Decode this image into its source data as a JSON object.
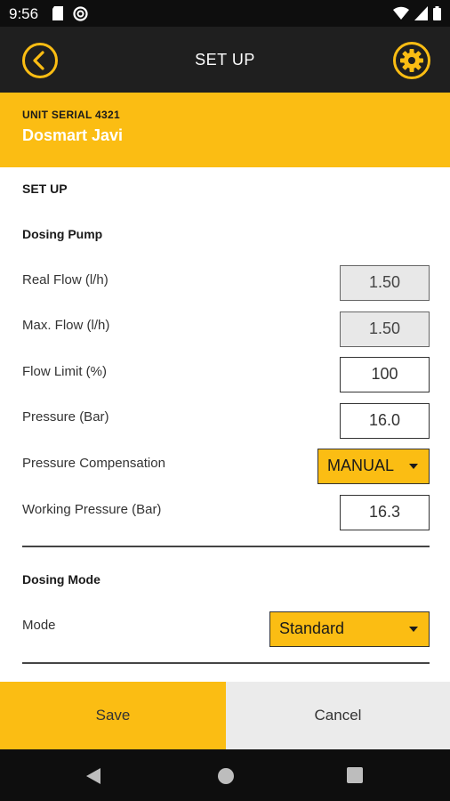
{
  "status_bar": {
    "time": "9:56",
    "icons_left": [
      "sd-card-icon",
      "do-not-disturb-icon"
    ],
    "icons_right": [
      "wifi-icon",
      "cellular-signal-icon",
      "battery-icon"
    ]
  },
  "header": {
    "title": "SET UP",
    "back_icon": "chevron-left-circle-icon",
    "settings_icon": "gear-icon",
    "accent_color": "#fbbd13"
  },
  "unit": {
    "serial": "UNIT SERIAL 4321",
    "name": "Dosmart Javi"
  },
  "setup": {
    "heading": "SET UP",
    "dosing_pump": {
      "heading": "Dosing Pump",
      "real_flow": {
        "label": "Real Flow (l/h)",
        "value": "1.50",
        "readonly": true
      },
      "max_flow": {
        "label": "Max. Flow (l/h)",
        "value": "1.50",
        "readonly": true
      },
      "flow_limit": {
        "label": "Flow Limit (%)",
        "value": "100"
      },
      "pressure": {
        "label": "Pressure (Bar)",
        "value": "16.0"
      },
      "pressure_compensation": {
        "label": "Pressure Compensation",
        "selected": "MANUAL"
      },
      "working_pressure": {
        "label": "Working Pressure (Bar)",
        "value": "16.3"
      }
    },
    "dosing_mode": {
      "heading": "Dosing Mode",
      "mode": {
        "label": "Mode",
        "selected": "Standard"
      }
    }
  },
  "actions": {
    "save_label": "Save",
    "cancel_label": "Cancel"
  },
  "nav_bar": {
    "icons": [
      "back-triangle-icon",
      "home-circle-icon",
      "recents-square-icon"
    ]
  }
}
